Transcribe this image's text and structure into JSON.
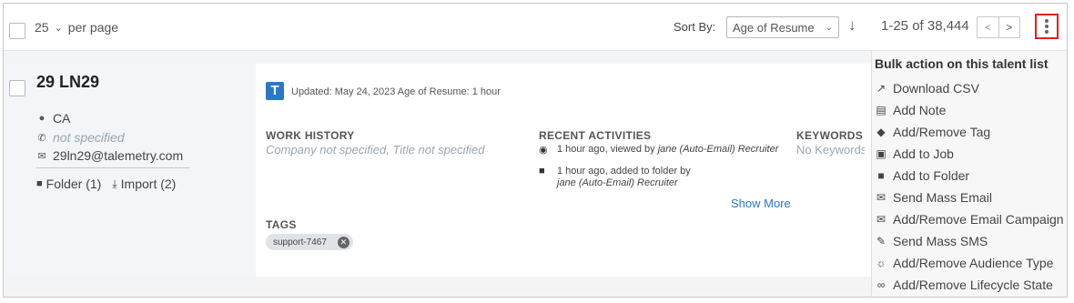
{
  "toolbar": {
    "per_page_value": "25",
    "per_page_label": "per page",
    "sort_label": "Sort By:",
    "sort_value": "Age of Resume",
    "range_text": "1-25 of 38,444",
    "prev_label": "<",
    "next_label": ">"
  },
  "candidate": {
    "name": "29 LN29",
    "location": "CA",
    "phone": "not specified",
    "email": "29ln29@talemetry.com",
    "folder_link": "Folder (1)",
    "import_link": "Import (2)",
    "badge_letter": "T",
    "updated_text": "Updated: May 24, 2023 Age of Resume: 1 hour",
    "work_history_heading": "WORK HISTORY",
    "work_history_value": "Company not specified, Title not specified",
    "recent_heading": "RECENT ACTIVITIES",
    "activity1_text": "1 hour ago, viewed by",
    "activity1_by": "jane (Auto-Email) Recruiter",
    "activity2_text": "1 hour ago, added to folder by",
    "activity2_by": "jane (Auto-Email) Recruiter",
    "show_more": "Show More",
    "keywords_heading": "KEYWORDS",
    "keywords_value": "No Keywords",
    "tags_heading": "TAGS",
    "tag": "support-7467"
  },
  "menu": {
    "title": "Bulk action on this talent list",
    "items": [
      {
        "label": "Download CSV",
        "icon": "external-link-icon"
      },
      {
        "label": "Add Note",
        "icon": "note-icon"
      },
      {
        "label": "Add/Remove Tag",
        "icon": "tag-icon"
      },
      {
        "label": "Add to Job",
        "icon": "briefcase-icon"
      },
      {
        "label": "Add to Folder",
        "icon": "folder-icon"
      },
      {
        "label": "Send Mass Email",
        "icon": "envelope-icon"
      },
      {
        "label": "Add/Remove Email Campaign",
        "icon": "envelope-open-icon"
      },
      {
        "label": "Send Mass SMS",
        "icon": "sms-icon"
      },
      {
        "label": "Add/Remove Audience Type",
        "icon": "audience-icon"
      },
      {
        "label": "Add/Remove Lifecycle State",
        "icon": "infinity-icon"
      }
    ]
  },
  "colors": {
    "accent_blue": "#2a78c8",
    "highlight_red": "#e02020"
  }
}
